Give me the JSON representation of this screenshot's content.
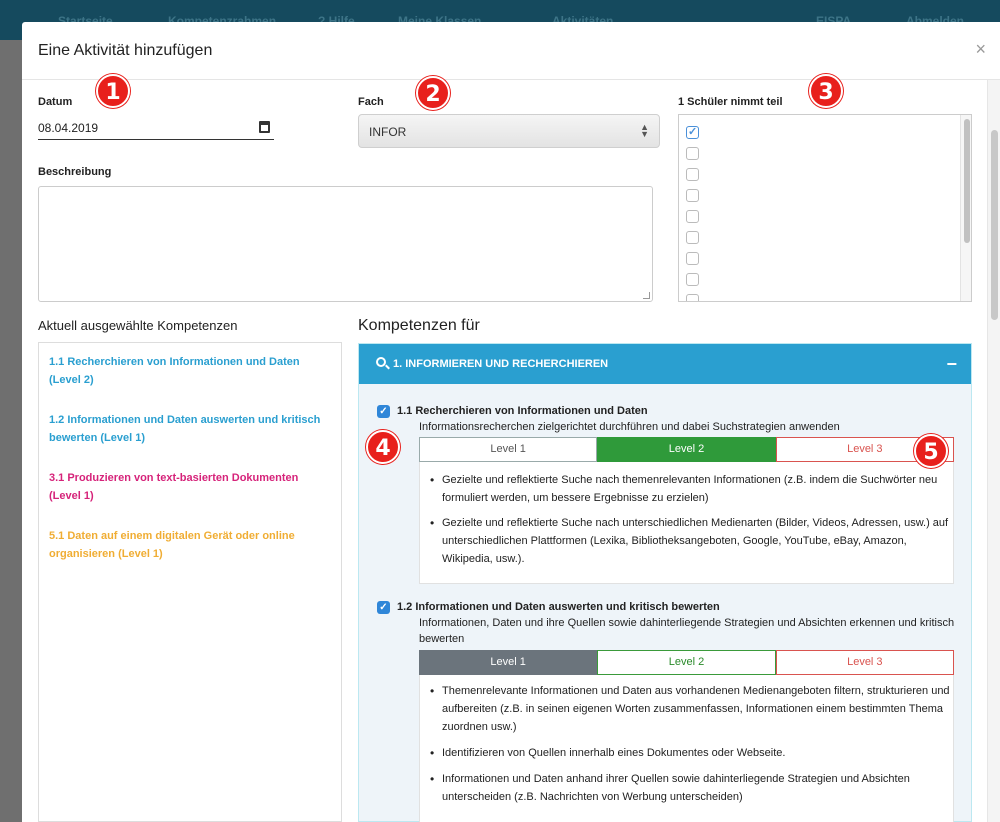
{
  "nav": {
    "items": [
      "Startseite",
      "Kompetenzrahmen",
      "? Hilfe",
      "Meine Klassen",
      "Aktivitäten",
      "EISPA",
      "Abmelden"
    ]
  },
  "modal": {
    "title": "Eine Aktivität hinzufügen",
    "close_label": "×"
  },
  "form": {
    "date_label": "Datum",
    "date_value": "08.04.2019",
    "subject_label": "Fach",
    "subject_value": "INFOR",
    "description_label": "Beschreibung",
    "description_value": "",
    "students_label": "1 Schüler nimmt teil",
    "students_checked": [
      true,
      false,
      false,
      false,
      false,
      false,
      false,
      false,
      false
    ]
  },
  "annotations": [
    "1",
    "2",
    "3",
    "4",
    "5"
  ],
  "current": {
    "title": "Aktuell ausgewählte Kompetenzen",
    "items": [
      {
        "text": "1.1 Recherchieren von Informationen und Daten (Level 2)",
        "color": "#2a9fd0"
      },
      {
        "text": "1.2 Informationen und Daten auswerten und kritisch bewerten (Level 1)",
        "color": "#2a9fd0"
      },
      {
        "text": "3.1 Produzieren von text-basierten Dokumenten (Level 1)",
        "color": "#d6237a"
      },
      {
        "text": "5.1 Daten auf einem digitalen Gerät oder online organisieren (Level 1)",
        "color": "#f0ad33"
      }
    ]
  },
  "competences": {
    "title": "Kompetenzen für",
    "panel_title": "1. INFORMIEREN UND RECHERCHIEREN",
    "collapse_label": "−",
    "items": [
      {
        "title": "1.1 Recherchieren von Informationen und Daten",
        "description": "Informationsrecherchen zielgerichtet durchführen und dabei Suchstrategien anwenden",
        "levels": [
          "Level 1",
          "Level 2",
          "Level 3"
        ],
        "selected_level": "Level 2",
        "indicators": [
          "Gezielte und reflektierte Suche nach themenrelevanten Informationen (z.B. indem die Suchwörter neu formuliert werden, um bessere Ergebnisse zu erzielen)",
          "Gezielte und reflektierte Suche nach unterschiedlichen Medienarten (Bilder, Videos, Adressen, usw.) auf unterschiedlichen Plattformen (Lexika, Bibliotheksangeboten, Google, YouTube, eBay, Amazon, Wikipedia, usw.)."
        ]
      },
      {
        "title": "1.2 Informationen und Daten auswerten und kritisch bewerten",
        "description": "Informationen, Daten und ihre Quellen sowie dahinterliegende Strategien und Absichten erkennen und kritisch bewerten",
        "levels": [
          "Level 1",
          "Level 2",
          "Level 3"
        ],
        "selected_level": "Level 1",
        "indicators": [
          "Themenrelevante Informationen und Daten aus vorhandenen Medienangeboten filtern, strukturieren und aufbereiten (z.B. in seinen eigenen Worten zusammenfassen, Informationen einem bestimmten Thema zuordnen usw.)",
          "Identifizieren von Quellen innerhalb eines Dokumentes oder Webseite.",
          "Informationen und Daten anhand ihrer Quellen sowie dahinterliegende Strategien und Absichten unterscheiden (z.B. Nachrichten von Werbung unterscheiden)"
        ]
      }
    ]
  }
}
